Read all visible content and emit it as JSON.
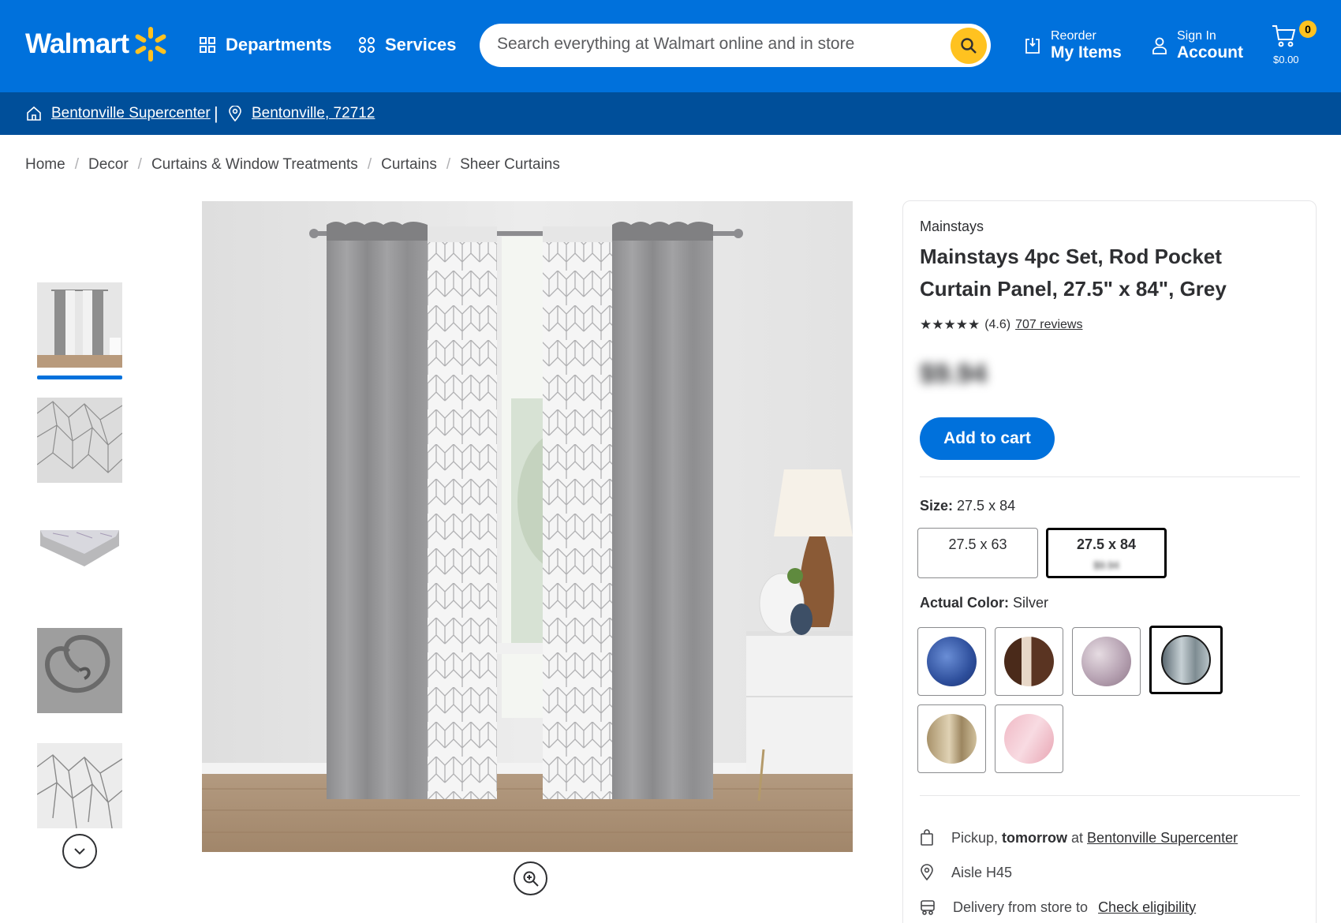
{
  "header": {
    "logo_text": "Walmart",
    "departments_label": "Departments",
    "services_label": "Services",
    "search_placeholder": "Search everything at Walmart online and in store",
    "reorder_small": "Reorder",
    "reorder_big": "My Items",
    "signin_small": "Sign In",
    "signin_big": "Account",
    "cart_count": "0",
    "cart_total": "$0.00"
  },
  "storebar": {
    "store_name": "Bentonville Supercenter",
    "separator": "|",
    "location": "Bentonville, 72712"
  },
  "breadcrumb": [
    "Home",
    "Decor",
    "Curtains & Window Treatments",
    "Curtains",
    "Sheer Curtains"
  ],
  "product": {
    "brand": "Mainstays",
    "title": "Mainstays 4pc Set, Rod Pocket Curtain Panel, 27.5\" x 84\", Grey",
    "stars": "★★★★★",
    "rating": "(4.6)",
    "reviews": "707 reviews",
    "rating_value": 4.6,
    "price": "$9.94",
    "add_to_cart": "Add to cart",
    "size_label": "Size:",
    "size_value": "27.5 x 84",
    "sizes": [
      {
        "label": "27.5 x 63",
        "sub": ""
      },
      {
        "label": "27.5 x 84",
        "sub": "$9.94"
      }
    ],
    "color_label": "Actual Color:",
    "color_value": "Silver",
    "colors": [
      "blue",
      "brown",
      "floral-mauve",
      "silver",
      "beige",
      "pink"
    ]
  },
  "fulfillment": {
    "pickup_prefix": "Pickup, ",
    "pickup_when": "tomorrow",
    "pickup_at": " at ",
    "pickup_store": "Bentonville Supercenter",
    "aisle": "Aisle H45",
    "delivery_prefix": "Delivery from store to",
    "delivery_link": "Check eligibility"
  },
  "colors": {
    "brand_blue": "#0071dc",
    "dark_blue": "#004f9a",
    "spark_yellow": "#ffc220"
  }
}
